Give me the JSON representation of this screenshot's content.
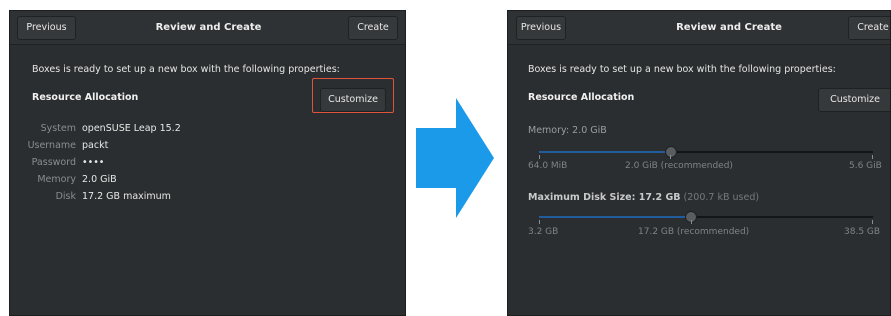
{
  "review_window": {
    "previous_label": "Previous",
    "title": "Review and Create",
    "create_label": "Create",
    "intro": "Boxes is ready to set up a new box with the following properties:",
    "section_title": "Resource Allocation",
    "customize_label": "Customize",
    "properties": [
      {
        "label": "System",
        "value": "openSUSE Leap 15.2"
      },
      {
        "label": "Username",
        "value": "packt"
      },
      {
        "label": "Password",
        "value": "••••"
      },
      {
        "label": "Memory",
        "value": "2.0 GiB"
      },
      {
        "label": "Disk",
        "value": "17.2 GB maximum"
      }
    ]
  },
  "customize_window": {
    "previous_label": "Previous",
    "title": "Review and Create",
    "create_label": "Create",
    "intro": "Boxes is ready to set up a new box with the following properties:",
    "section_title": "Resource Allocation",
    "customize_label": "Customize",
    "memory": {
      "title": "Memory: 2.0 GiB",
      "level": 0.396,
      "min_label": "64.0 MiB",
      "recommended_label": "2.0 GiB (recommended)",
      "max_label": "5.6 GiB"
    },
    "disk": {
      "title": "Maximum Disk Size: 17.2 GB",
      "used_note": "(200.7 kB used)",
      "level": 0.455,
      "min_label": "3.2 GB",
      "recommended_label": "17.2 GB (recommended)",
      "max_label": "38.5 GB"
    }
  },
  "colors": {
    "arrow": "#1b9aea",
    "highlight": "#e0533a",
    "window_bg": "#2b2e30",
    "slider_fill": "#215d9c"
  },
  "icons": {
    "transition": "right-arrow-icon"
  }
}
